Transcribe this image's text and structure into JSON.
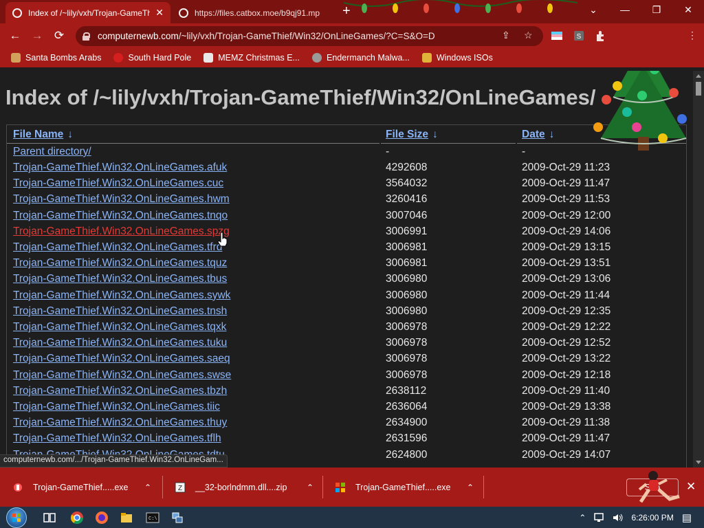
{
  "tabs": [
    {
      "title": "Index of /~lily/vxh/Trojan-GameThief",
      "close": "✕"
    },
    {
      "title": "https://files.catbox.moe/b9qj91.mp"
    }
  ],
  "tab_new": "+",
  "window_controls": {
    "expand": "⌄",
    "minimize": "—",
    "maximize": "❐",
    "close": "✕"
  },
  "toolbar": {
    "back": "←",
    "forward": "→",
    "reload": "⟳",
    "url_host": "computernewb.com",
    "url_path": "/~lily/vxh/Trojan-GameThief/Win32/OnLineGames/?C=S&O=D",
    "share": "⇪",
    "bookmark_star": "☆",
    "extensions": "⋮"
  },
  "bookmarks": [
    {
      "label": "Santa Bombs Arabs",
      "color": "#d2a15b"
    },
    {
      "label": "South Hard Pole",
      "color": "#d61f1f"
    },
    {
      "label": "MEMZ Christmas E...",
      "color": "#e8e8e8"
    },
    {
      "label": "Endermanch Malwa...",
      "color": "#9a9a9a"
    },
    {
      "label": "Windows ISOs",
      "color": "#e0b23a"
    }
  ],
  "page": {
    "heading": "Index of /~lily/vxh/Trojan-GameThief/Win32/OnLineGames/",
    "columns": {
      "name": "File Name",
      "size": "File Size",
      "date": "Date",
      "sort_arrow": "↓"
    },
    "parent": {
      "name": "Parent directory/",
      "size": "-",
      "date": "-"
    },
    "files": [
      {
        "name": "Trojan-GameThief.Win32.OnLineGames.afuk",
        "size": "4292608",
        "date": "2009-Oct-29 11:23"
      },
      {
        "name": "Trojan-GameThief.Win32.OnLineGames.cuc",
        "size": "3564032",
        "date": "2009-Oct-29 11:47"
      },
      {
        "name": "Trojan-GameThief.Win32.OnLineGames.hwm",
        "size": "3260416",
        "date": "2009-Oct-29 11:53"
      },
      {
        "name": "Trojan-GameThief.Win32.OnLineGames.tnqo",
        "size": "3007046",
        "date": "2009-Oct-29 12:00"
      },
      {
        "name": "Trojan-GameThief.Win32.OnLineGames.spzg",
        "size": "3006991",
        "date": "2009-Oct-29 14:06"
      },
      {
        "name": "Trojan-GameThief.Win32.OnLineGames.tfrd",
        "size": "3006981",
        "date": "2009-Oct-29 13:15"
      },
      {
        "name": "Trojan-GameThief.Win32.OnLineGames.tquz",
        "size": "3006981",
        "date": "2009-Oct-29 13:51"
      },
      {
        "name": "Trojan-GameThief.Win32.OnLineGames.tbus",
        "size": "3006980",
        "date": "2009-Oct-29 13:06"
      },
      {
        "name": "Trojan-GameThief.Win32.OnLineGames.sywk",
        "size": "3006980",
        "date": "2009-Oct-29 11:44"
      },
      {
        "name": "Trojan-GameThief.Win32.OnLineGames.tnsh",
        "size": "3006980",
        "date": "2009-Oct-29 12:35"
      },
      {
        "name": "Trojan-GameThief.Win32.OnLineGames.tqxk",
        "size": "3006978",
        "date": "2009-Oct-29 12:22"
      },
      {
        "name": "Trojan-GameThief.Win32.OnLineGames.tuku",
        "size": "3006978",
        "date": "2009-Oct-29 12:52"
      },
      {
        "name": "Trojan-GameThief.Win32.OnLineGames.saeq",
        "size": "3006978",
        "date": "2009-Oct-29 13:22"
      },
      {
        "name": "Trojan-GameThief.Win32.OnLineGames.swse",
        "size": "3006978",
        "date": "2009-Oct-29 12:18"
      },
      {
        "name": "Trojan-GameThief.Win32.OnLineGames.tbzh",
        "size": "2638112",
        "date": "2009-Oct-29 11:40"
      },
      {
        "name": "Trojan-GameThief.Win32.OnLineGames.tiic",
        "size": "2636064",
        "date": "2009-Oct-29 13:38"
      },
      {
        "name": "Trojan-GameThief.Win32.OnLineGames.thuy",
        "size": "2634900",
        "date": "2009-Oct-29 11:38"
      },
      {
        "name": "Trojan-GameThief.Win32.OnLineGames.tflh",
        "size": "2631596",
        "date": "2009-Oct-29 11:47"
      },
      {
        "name": "Trojan-GameThief.Win32.OnLineGames.tdtu",
        "size": "2624800",
        "date": "2009-Oct-29 14:07"
      }
    ]
  },
  "status_url": "computernewb.com/.../Trojan-GameThief.Win32.OnLineGam...",
  "downloads": {
    "items": [
      {
        "name": "Trojan-GameThief.....exe",
        "icon": "red-app-icon",
        "chevron": "⌃"
      },
      {
        "name": "__32-borlndmm.dll....zip",
        "icon": "zip-archive-icon",
        "chevron": "⌃"
      },
      {
        "name": "Trojan-GameThief.....exe",
        "icon": "windows-flag-icon",
        "chevron": "⌃"
      }
    ],
    "show_all": "Sho",
    "close": "✕"
  },
  "taskbar": {
    "clock": "6:26:00 PM",
    "tray_up": "⌃",
    "notifications": "▤"
  },
  "colors": {
    "chrome_red": "#a51b17",
    "tab_strip": "#7a1310",
    "link": "#8ab4f8",
    "hover_link": "#e53935"
  }
}
